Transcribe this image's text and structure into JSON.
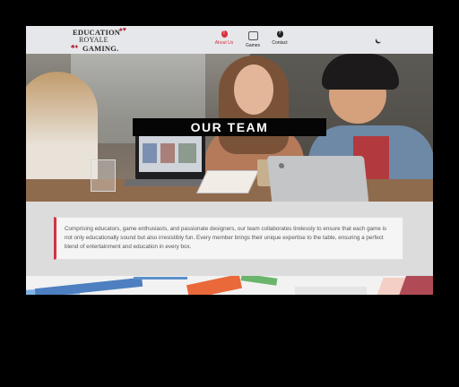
{
  "header": {
    "logo": {
      "line1": "EDUCATION",
      "line2": "ROYALE",
      "line3": "GAMING.",
      "suit_top": "♠♥",
      "suit_bottom": "♣♦"
    },
    "nav": [
      {
        "label": "About Us",
        "icon": "info-icon",
        "active": true
      },
      {
        "label": "Games",
        "icon": "gamepad-icon",
        "active": false
      },
      {
        "label": "Contact",
        "icon": "help-icon",
        "active": false
      }
    ],
    "theme_toggle_icon": "moon-icon"
  },
  "hero": {
    "title": "OUR TEAM",
    "image": "team-at-table-photo"
  },
  "intro": {
    "text": "Comprising educators, game enthusiasts, and passionate designers, our team collaborates tirelessly to ensure that each game is not only educationally sound but also irresistibly fun. Every member brings their unique expertise to the table, ensuring a perfect blend of entertainment and education in every box."
  },
  "colors": {
    "accent": "#d9313c",
    "nav_bg": "#e6e7ea",
    "page_bg": "#dcdcdc",
    "card_bg": "#f5f5f6"
  }
}
